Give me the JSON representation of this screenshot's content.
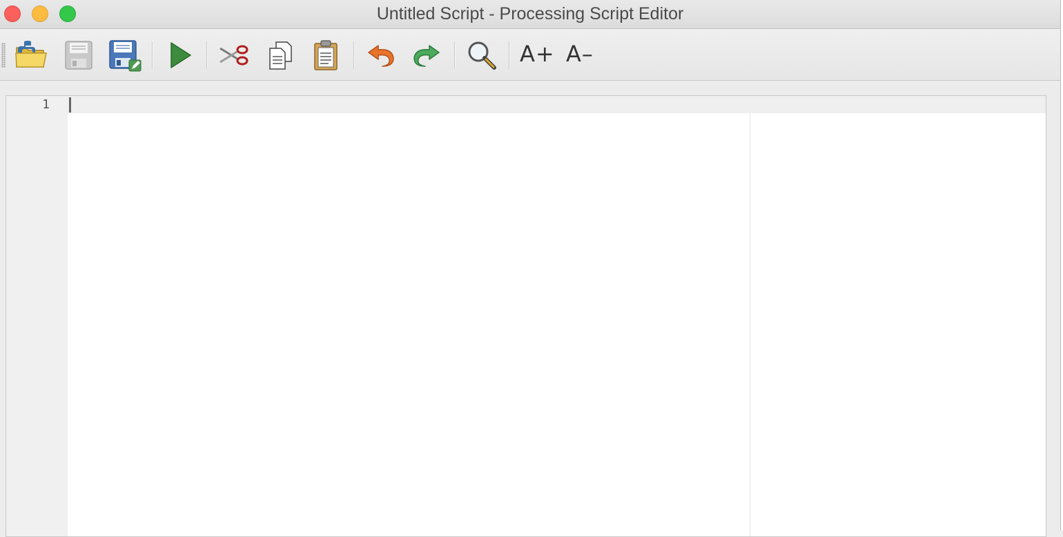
{
  "window": {
    "title": "Untitled Script - Processing Script Editor"
  },
  "toolbar": {
    "buttons": [
      {
        "name": "open-script",
        "icon": "open-folder-python-icon"
      },
      {
        "name": "save-script",
        "icon": "save-disabled-icon"
      },
      {
        "name": "save-as",
        "icon": "save-as-icon"
      },
      {
        "name": "run",
        "icon": "play-icon"
      },
      {
        "name": "cut",
        "icon": "scissors-icon"
      },
      {
        "name": "copy",
        "icon": "copy-icon"
      },
      {
        "name": "paste",
        "icon": "paste-icon"
      },
      {
        "name": "undo",
        "icon": "undo-icon"
      },
      {
        "name": "redo",
        "icon": "redo-icon"
      },
      {
        "name": "find",
        "icon": "magnifier-icon"
      }
    ],
    "increase_font_label": "A+",
    "decrease_font_label": "A–"
  },
  "editor": {
    "line_numbers": [
      "1"
    ],
    "code": ""
  },
  "colors": {
    "close": "#fc605c",
    "minimize": "#fdbc40",
    "zoom": "#34c84a",
    "run_green": "#3d8b3d",
    "undo_orange": "#e8742a",
    "redo_green": "#4caa5c"
  }
}
